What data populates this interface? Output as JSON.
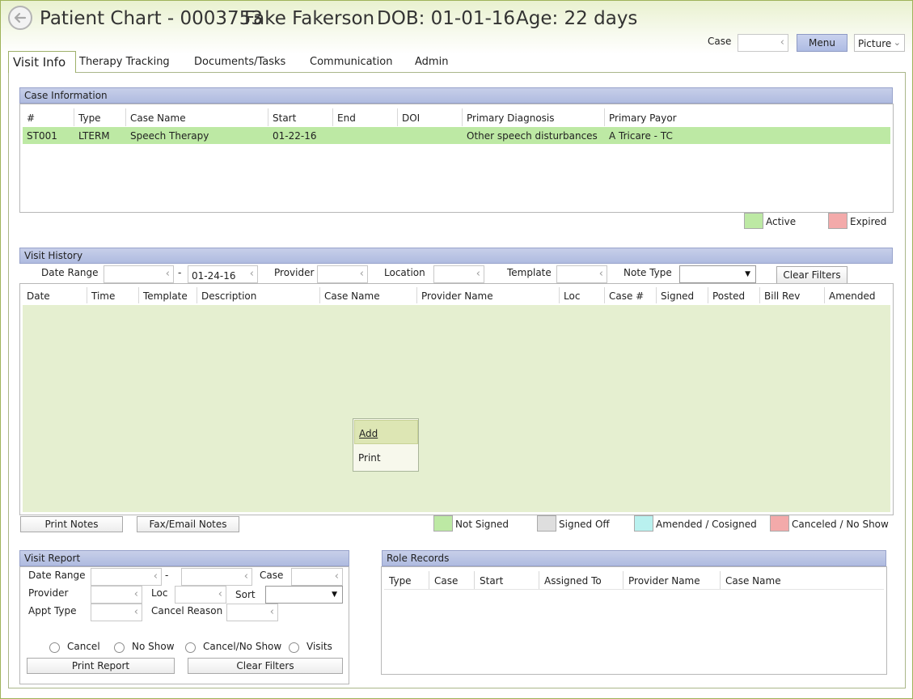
{
  "header": {
    "title": "Patient Chart - 0003753",
    "patient_name": "Fake Fakerson",
    "dob": "DOB: 01-01-16",
    "age": "Age: 22 days",
    "case_label": "Case",
    "case_value": "",
    "menu_label": "Menu",
    "view_select": "Picture"
  },
  "tabs": [
    {
      "label": "Visit Info",
      "active": true
    },
    {
      "label": "Therapy Tracking"
    },
    {
      "label": "Documents/Tasks"
    },
    {
      "label": "Communication"
    },
    {
      "label": "Admin"
    }
  ],
  "case_information": {
    "title": "Case Information",
    "columns": [
      "#",
      "Type",
      "Case Name",
      "Start",
      "End",
      "DOI",
      "Primary Diagnosis",
      "Primary Payor"
    ],
    "rows": [
      [
        "ST001",
        "LTERM",
        "Speech Therapy",
        "01-22-16",
        "",
        "",
        "Other speech disturbances",
        "A Tricare - TC"
      ]
    ],
    "legend": [
      {
        "label": "Active",
        "color": "#bde9a4"
      },
      {
        "label": "Expired",
        "color": "#f3aaaa"
      }
    ]
  },
  "visit_history": {
    "title": "Visit History",
    "filters": {
      "date_range_label": "Date Range",
      "date_from": "",
      "date_sep": "-",
      "date_to": "01-24-16",
      "provider_label": "Provider",
      "provider_value": "",
      "location_label": "Location",
      "location_value": "",
      "template_label": "Template",
      "template_value": "",
      "note_type_label": "Note Type",
      "note_type_value": "",
      "clear_filters": "Clear Filters"
    },
    "columns": [
      "Date",
      "Time",
      "Template",
      "Description",
      "Case Name",
      "Provider Name",
      "Loc",
      "Case #",
      "Signed",
      "Posted",
      "Bill Rev",
      "Amended"
    ],
    "rows": [],
    "context_menu": [
      "Add",
      "Print"
    ],
    "print_notes": "Print Notes",
    "fax_email_notes": "Fax/Email Notes",
    "legend": [
      {
        "label": "Not Signed",
        "color": "#bde9a4"
      },
      {
        "label": "Signed Off",
        "color": "#dedede"
      },
      {
        "label": "Amended / Cosigned",
        "color": "#b9f1ef"
      },
      {
        "label": "Canceled / No Show",
        "color": "#f3aaaa"
      }
    ]
  },
  "visit_report": {
    "title": "Visit Report",
    "date_range_label": "Date Range",
    "date_sep": "-",
    "case_label": "Case",
    "provider_label": "Provider",
    "loc_label": "Loc",
    "sort_label": "Sort",
    "appt_type_label": "Appt Type",
    "cancel_reason_label": "Cancel Reason",
    "radios": [
      "Cancel",
      "No Show",
      "Cancel/No Show",
      "Visits"
    ],
    "print_report": "Print Report",
    "clear_filters": "Clear Filters"
  },
  "role_records": {
    "title": "Role Records",
    "columns": [
      "Type",
      "Case",
      "Start",
      "Assigned To",
      "Provider Name",
      "Case Name"
    ],
    "rows": []
  }
}
